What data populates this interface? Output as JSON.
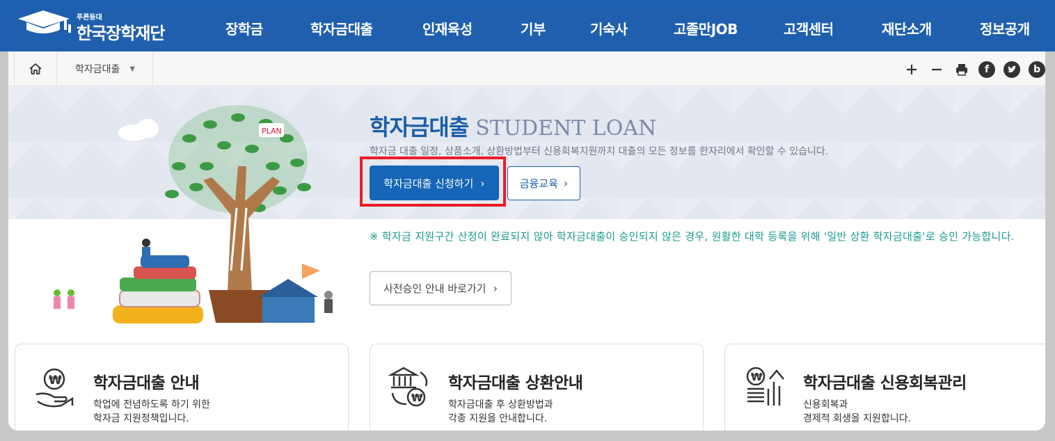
{
  "header": {
    "logo_sub": "푸른등대",
    "logo_main": "한국장학재단",
    "nav": [
      "장학금",
      "학자금대출",
      "인재육성",
      "기부",
      "기숙사",
      "고졸만JOB",
      "고객센터",
      "재단소개",
      "정보공개"
    ]
  },
  "location": {
    "breadcrumb": "학자금대출",
    "caret": "▼",
    "tools": [
      "plus-icon",
      "minus-icon",
      "print-icon",
      "facebook-icon",
      "twitter-icon",
      "blog-icon"
    ]
  },
  "hero": {
    "title_ko": "학자금대출",
    "title_en": "STUDENT LOAN",
    "description": "학자금 대출 일정, 상품소개, 상환방법부터 신용회복지원까지 대출의 모든 정보를 한자리에서 확인할 수 있습니다.",
    "primary_button": "학자금대출 신청하기",
    "secondary_button": "금융교육",
    "notice": "※ 학자금 지원구간 산정이 완료되지 않아 학자금대출이 승인되지 않은 경우, 원활한 대학 등록을 위해 '일반 상환 학자금대출'로 승인 가능합니다.",
    "preapproval_button": "사전승인 안내 바로가기"
  },
  "cards": [
    {
      "title": "학자금대출 안내",
      "desc_line1": "학업에 전념하도록 하기 위한",
      "desc_line2": "학자금 지원정책입니다."
    },
    {
      "title": "학자금대출 상환안내",
      "desc_line1": "학자금대출 후 상환방법과",
      "desc_line2": "각종 지원을 안내합니다."
    },
    {
      "title": "학자금대출 신용회복관리",
      "desc_line1": "신용회복과",
      "desc_line2": "경제적 회생을 지원합니다."
    }
  ],
  "colors": {
    "brand_blue": "#1d5fb0",
    "primary_button": "#1565b8",
    "highlight": "#ec1c24",
    "notice_teal": "#1a9b8e"
  }
}
